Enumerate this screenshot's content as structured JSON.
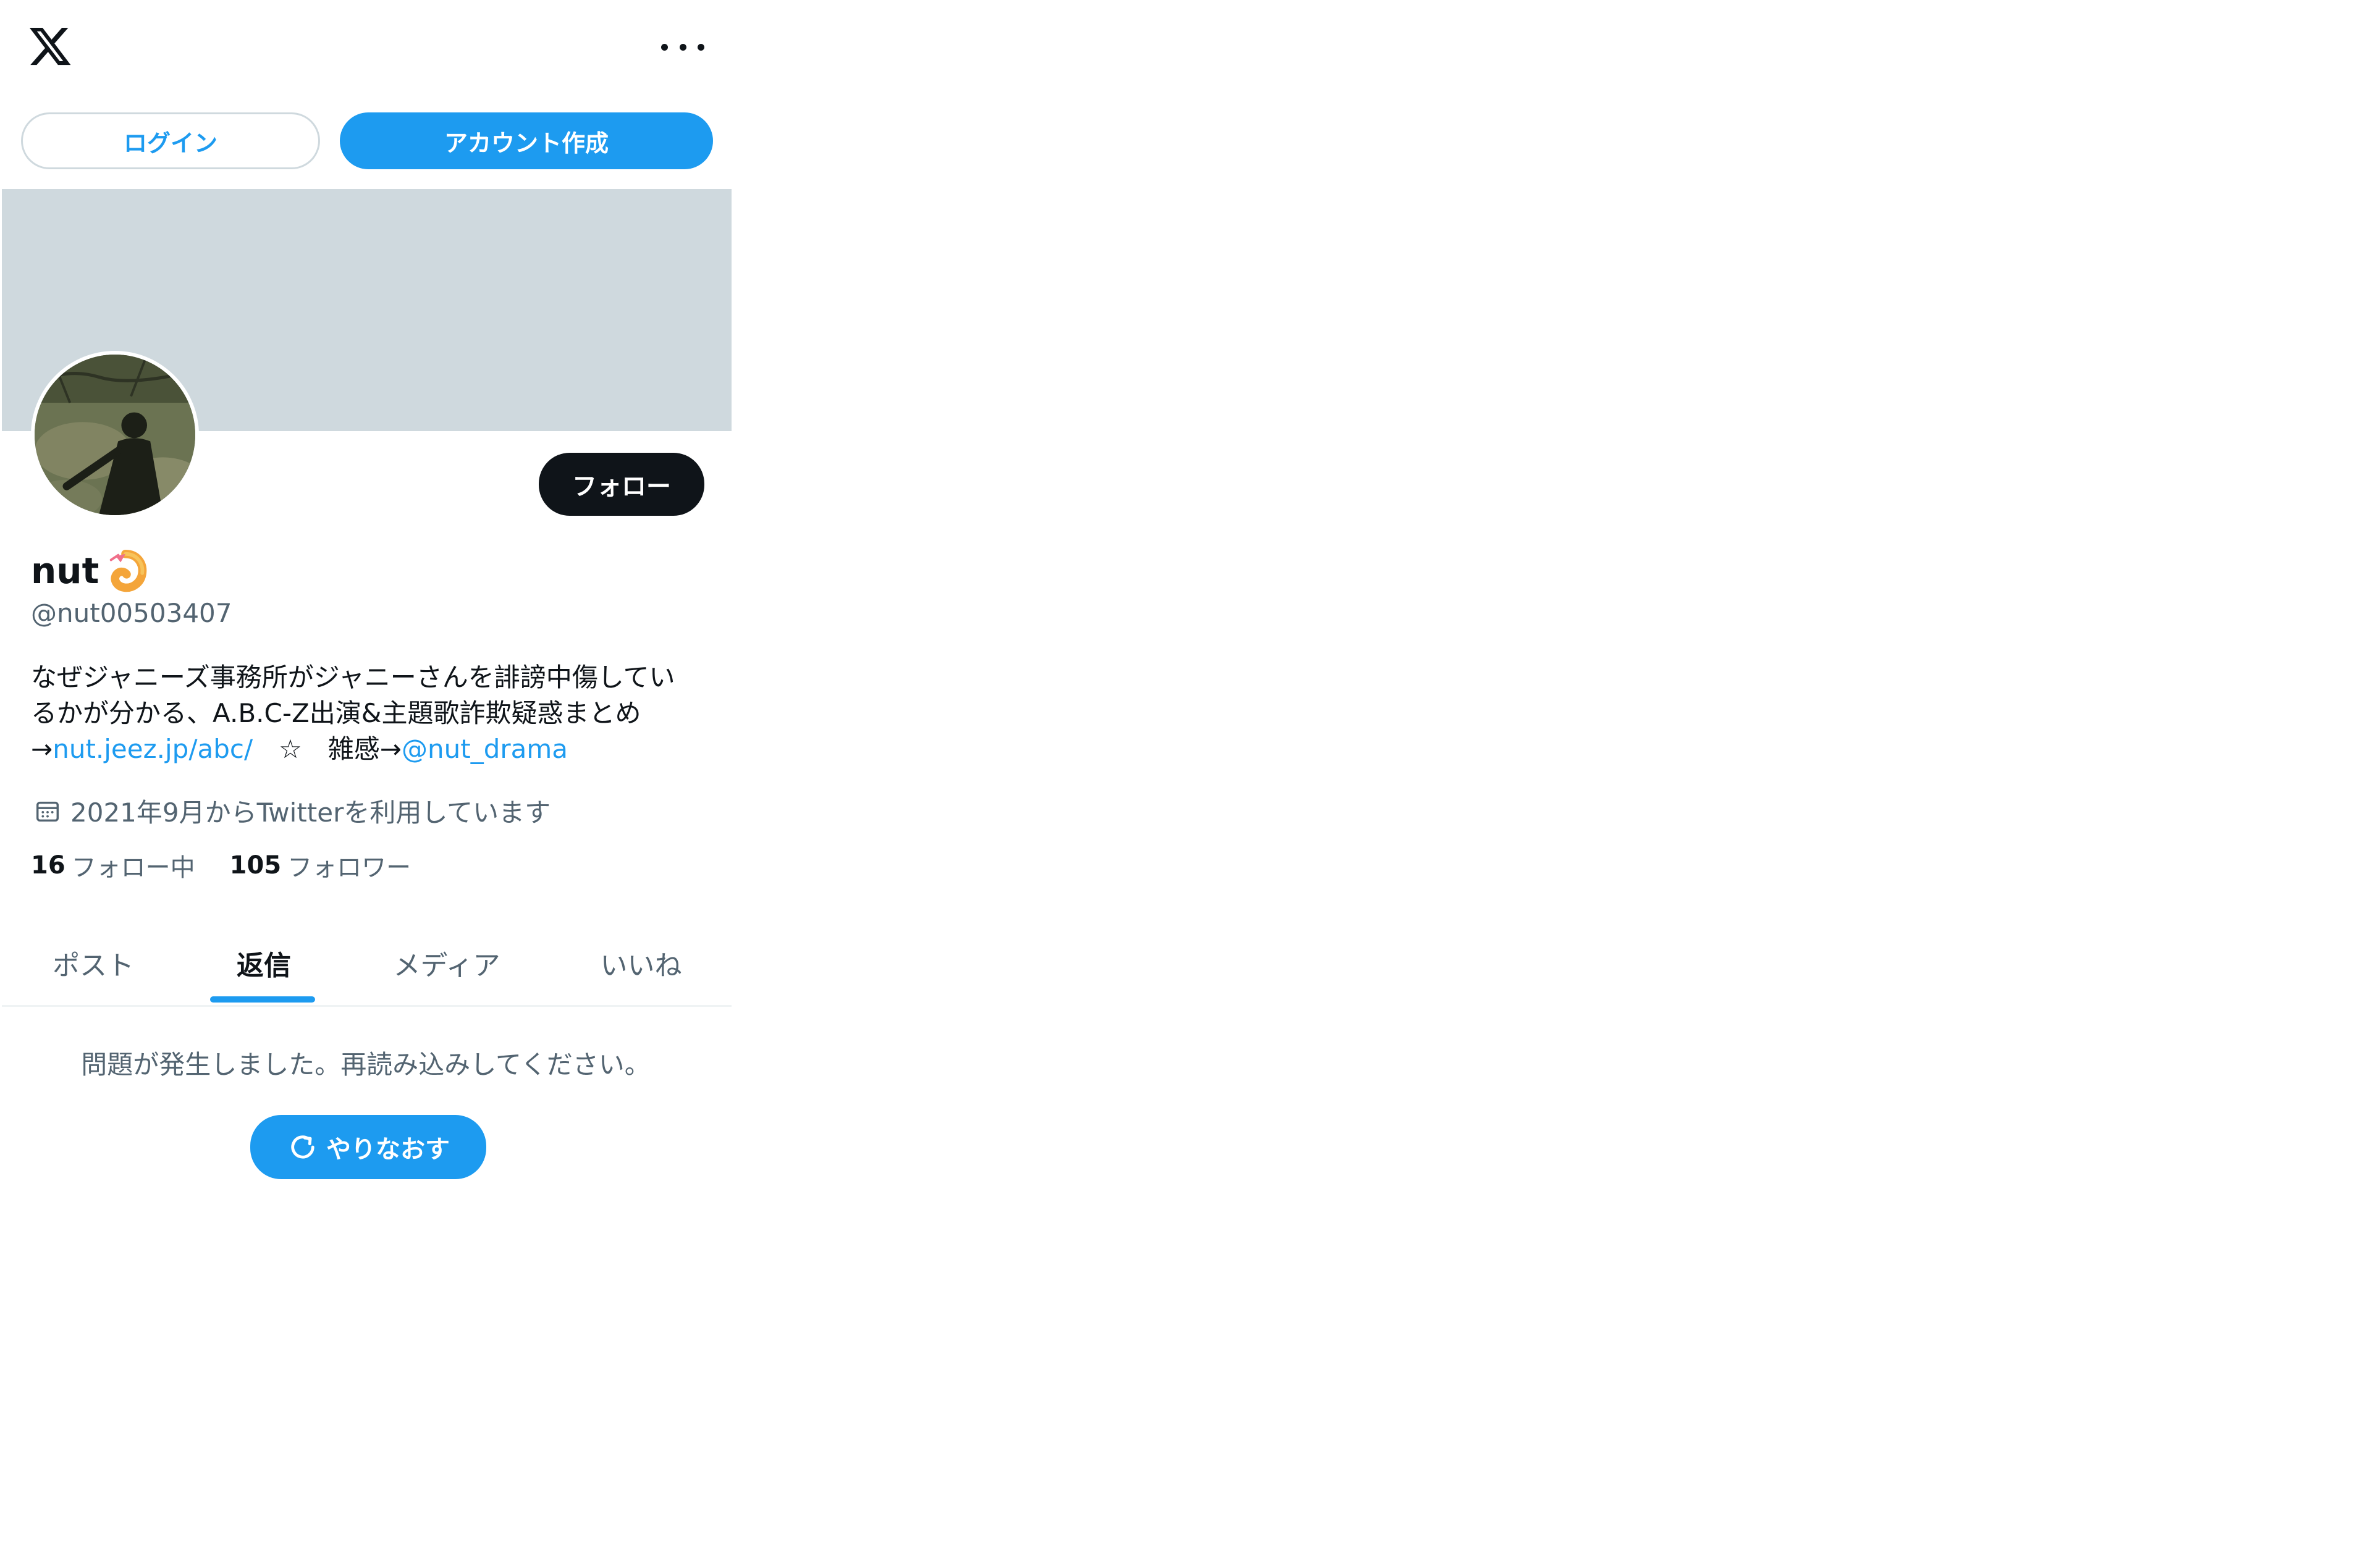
{
  "header": {
    "logo_icon": "x-logo-icon",
    "more_icon": "more-options-icon"
  },
  "auth": {
    "login_label": "ログイン",
    "signup_label": "アカウント作成"
  },
  "profile": {
    "name": "nut",
    "name_emoji": "shrimp-icon",
    "handle": "@nut00503407",
    "follow_label": "フォロー",
    "bio": {
      "line1": "なぜジャニーズ事務所がジャニーさんを誹謗中傷してい",
      "line2": "るかが分かる、A.B.C-Z出演&主題歌詐欺疑惑まとめ",
      "arrow1": "→",
      "link1": "nut.jeez.jp/abc/",
      "mid": "　☆　雑感→",
      "link2": "@nut_drama"
    },
    "joined": "2021年9月からTwitterを利用しています",
    "following_count": "16",
    "following_label": "フォロー中",
    "followers_count": "105",
    "followers_label": "フォロワー"
  },
  "tabs": [
    {
      "label": "ポスト"
    },
    {
      "label": "返信"
    },
    {
      "label": "メディア"
    },
    {
      "label": "いいね"
    }
  ],
  "active_tab": "返信",
  "error": {
    "message": "問題が発生しました。再読み込みしてください。",
    "retry_label": "やりなおす"
  },
  "colors": {
    "accent": "#1d9bf0",
    "banner": "#cfd9de",
    "text_primary": "#0f1419",
    "text_secondary": "#536471"
  }
}
